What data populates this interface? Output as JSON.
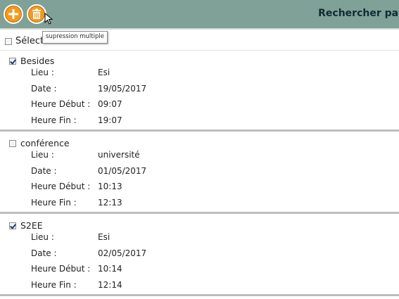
{
  "toolbar": {
    "add_icon": "plus-icon",
    "delete_icon": "trash-icon",
    "search_title": "Rechercher par",
    "tooltip": "supression multiple",
    "accent": "#f39a1c",
    "bar_color": "#7fa197"
  },
  "select_all": {
    "label": "Sélect",
    "checked": false
  },
  "field_labels": {
    "lieu": "Lieu :",
    "date": "Date :",
    "debut": "Heure Début :",
    "fin": "Heure Fin :"
  },
  "events": [
    {
      "title": "Besides",
      "checked": true,
      "lieu": "Esi",
      "date": "19/05/2017",
      "debut": "09:07",
      "fin": "19:07"
    },
    {
      "title": "conférence",
      "checked": false,
      "lieu": "université",
      "date": "01/05/2017",
      "debut": "10:13",
      "fin": "12:13"
    },
    {
      "title": "S2EE",
      "checked": true,
      "lieu": "Esi",
      "date": "02/05/2017",
      "debut": "10:14",
      "fin": "12:14"
    }
  ]
}
